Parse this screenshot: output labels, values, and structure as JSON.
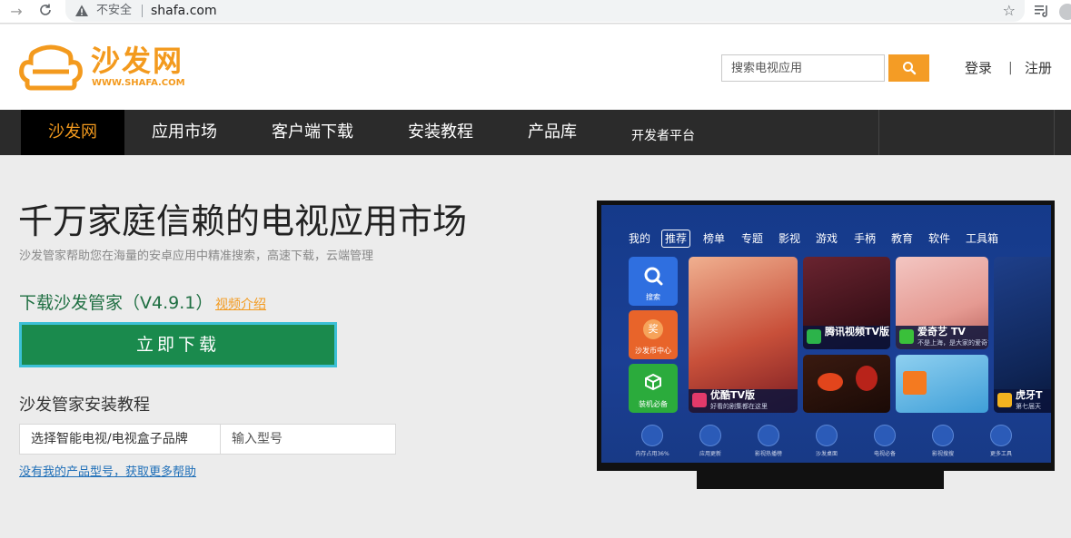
{
  "browser": {
    "insecure_label": "不安全",
    "url": "shafa.com"
  },
  "header": {
    "logo_cn": "沙发网",
    "logo_en": "WWW.SHAFA.COM",
    "search_placeholder": "搜索电视应用",
    "login": "登录",
    "separator": "|",
    "register": "注册",
    "brand_color": "#f39a1e"
  },
  "nav": {
    "items": [
      {
        "label": "沙发网"
      },
      {
        "label": "应用市场"
      },
      {
        "label": "客户端下载"
      },
      {
        "label": "安装教程"
      },
      {
        "label": "产品库"
      },
      {
        "label": "开发者平台"
      }
    ]
  },
  "main": {
    "headline": "千万家庭信赖的电视应用市场",
    "subline": "沙发管家帮助您在海量的安卓应用中精准搜索，高速下载，云端管理",
    "download_title": "下载沙发管家（V4.9.1）",
    "video_link": "视频介绍",
    "download_button": "立即下载",
    "tutorial_title": "沙发管家安装教程",
    "brand_select": "选择智能电视/电视盒子品牌",
    "model_placeholder": "输入型号",
    "help_link": "没有我的产品型号，获取更多帮助"
  },
  "tv": {
    "menu": [
      "我的",
      "推荐",
      "榜单",
      "专题",
      "影视",
      "游戏",
      "手柄",
      "教育",
      "软件",
      "工具箱"
    ],
    "tiles": [
      {
        "label": "搜索"
      },
      {
        "label": "沙发币中心"
      },
      {
        "label": "装机必备"
      }
    ],
    "coin_glyph": "奖",
    "apps": [
      {
        "name": "优酷TV版",
        "desc": "好看的剧集都在这里"
      },
      {
        "name": "腾讯视频TV版",
        "desc": ""
      },
      {
        "name": "爱奇艺 TV",
        "desc": "不是上海，是大家的爱奇艺"
      },
      {
        "name": "虎牙T",
        "desc": "第七届天"
      }
    ],
    "bottom": [
      "内存占用36%",
      "应用更新",
      "影视热播榜",
      "沙发桌面",
      "电视必备",
      "影视搜搜",
      "更多工具"
    ]
  }
}
